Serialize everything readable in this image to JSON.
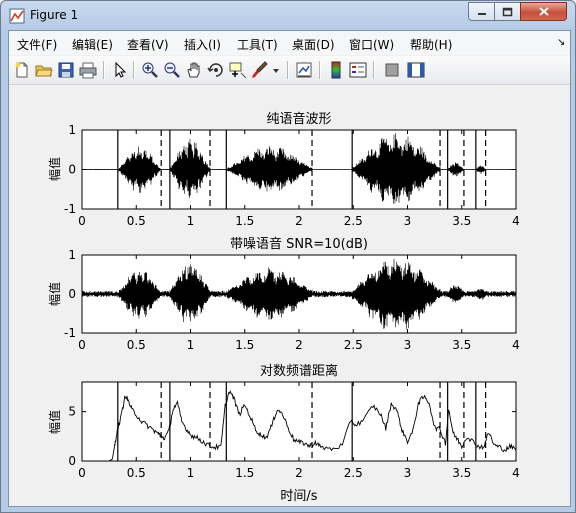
{
  "window": {
    "title": "Figure 1"
  },
  "menu": {
    "items": [
      "文件(F)",
      "编辑(E)",
      "查看(V)",
      "插入(I)",
      "工具(T)",
      "桌面(D)",
      "窗口(W)",
      "帮助(H)"
    ]
  },
  "toolbar": {
    "icons": [
      "new-figure-icon",
      "open-file-icon",
      "save-icon",
      "print-icon",
      "pointer-icon",
      "zoom-in-icon",
      "zoom-out-icon",
      "pan-hand-icon",
      "rotate-3d-icon",
      "data-cursor-icon",
      "brush-icon",
      "brush-dropdown-icon",
      "link-plot-icon",
      "colorbar-icon",
      "legend-icon",
      "hide-plot-tools-icon",
      "show-plot-tools-icon"
    ]
  },
  "colors": {
    "waveform": "#000000",
    "axes_bg": "#ffffff",
    "figure_bg": "#f0f0f0"
  },
  "chart_data": [
    {
      "type": "line",
      "title": "纯语音波形",
      "xlabel": "",
      "ylabel": "幅值",
      "xlim": [
        0,
        4
      ],
      "ylim": [
        -1,
        1
      ],
      "xticks": [
        "0",
        "0.5",
        "1",
        "1.5",
        "2",
        "2.5",
        "3",
        "3.5",
        "4"
      ],
      "yticks": [
        "-1",
        "0",
        "1"
      ],
      "series_description": "speech waveform, amplitude in [-1,1]",
      "speech_segments": [
        {
          "start": 0.34,
          "end": 0.72,
          "peak": 0.62
        },
        {
          "start": 0.81,
          "end": 1.18,
          "peak": 0.78
        },
        {
          "start": 1.34,
          "end": 2.12,
          "peak": 0.62
        },
        {
          "start": 2.49,
          "end": 3.3,
          "peak": 0.95
        },
        {
          "start": 3.37,
          "end": 3.52,
          "peak": 0.2
        },
        {
          "start": 3.63,
          "end": 3.72,
          "peak": 0.12
        }
      ],
      "solid_markers": [
        0.33,
        0.81,
        1.33,
        2.49,
        3.37,
        3.63
      ],
      "dashed_markers": [
        0.73,
        1.18,
        2.12,
        3.3,
        3.52,
        3.72
      ]
    },
    {
      "type": "line",
      "title": "带噪语音 SNR=10(dB)",
      "xlabel": "",
      "ylabel": "幅值",
      "xlim": [
        0,
        4
      ],
      "ylim": [
        -1,
        1
      ],
      "xticks": [
        "0",
        "0.5",
        "1",
        "1.5",
        "2",
        "2.5",
        "3",
        "3.5",
        "4"
      ],
      "yticks": [
        "-1",
        "0",
        "1"
      ],
      "noise_level": 0.06
    },
    {
      "type": "line",
      "title": "对数频谱距离",
      "xlabel": "时间/s",
      "ylabel": "幅值",
      "xlim": [
        0,
        4
      ],
      "ylim": [
        0,
        8
      ],
      "xticks": [
        "0",
        "0.5",
        "1",
        "1.5",
        "2",
        "2.5",
        "3",
        "3.5",
        "4"
      ],
      "yticks": [
        "0",
        "5"
      ],
      "x": [
        0,
        0.25,
        0.28,
        0.3,
        0.32,
        0.36,
        0.4,
        0.43,
        0.46,
        0.5,
        0.55,
        0.6,
        0.65,
        0.7,
        0.72,
        0.76,
        0.8,
        0.84,
        0.88,
        0.92,
        0.97,
        1.02,
        1.07,
        1.12,
        1.18,
        1.22,
        1.28,
        1.32,
        1.36,
        1.4,
        1.45,
        1.5,
        1.55,
        1.6,
        1.65,
        1.7,
        1.75,
        1.8,
        1.85,
        1.9,
        1.95,
        2.0,
        2.05,
        2.1,
        2.15,
        2.2,
        2.3,
        2.4,
        2.48,
        2.52,
        2.6,
        2.68,
        2.75,
        2.8,
        2.85,
        2.9,
        2.95,
        3.0,
        3.05,
        3.1,
        3.15,
        3.2,
        3.25,
        3.3,
        3.35,
        3.38,
        3.42,
        3.46,
        3.5,
        3.55,
        3.6,
        3.65,
        3.7,
        3.75,
        3.8,
        3.85,
        3.9,
        3.95,
        4.0
      ],
      "y": [
        0,
        0,
        0.2,
        1.5,
        2.8,
        4.5,
        6.7,
        6.0,
        5.2,
        4.7,
        4.0,
        3.6,
        3.2,
        2.8,
        2.6,
        2.3,
        3.0,
        5.3,
        5.8,
        4.0,
        3.1,
        2.5,
        2.3,
        1.9,
        1.5,
        1.4,
        1.4,
        5.6,
        7.1,
        6.3,
        4.7,
        5.7,
        4.5,
        3.2,
        2.6,
        2.4,
        3.6,
        5.3,
        4.7,
        3.4,
        2.2,
        1.9,
        1.8,
        1.5,
        1.9,
        1.4,
        1.2,
        1.6,
        4.2,
        3.6,
        4.2,
        5.6,
        4.8,
        3.3,
        5.8,
        5.2,
        3.1,
        2.0,
        3.0,
        5.9,
        6.5,
        5.9,
        3.4,
        3.2,
        1.8,
        5.3,
        2.8,
        2.2,
        1.5,
        2.5,
        2.0,
        1.5,
        1.4,
        2.9,
        1.6,
        1.4,
        1.1,
        1.5,
        1.1
      ],
      "solid_markers": [
        0.33,
        0.81,
        1.33,
        2.49,
        3.37,
        3.63
      ],
      "dashed_markers": [
        0.73,
        1.18,
        2.12,
        3.3,
        3.52,
        3.72
      ]
    }
  ]
}
